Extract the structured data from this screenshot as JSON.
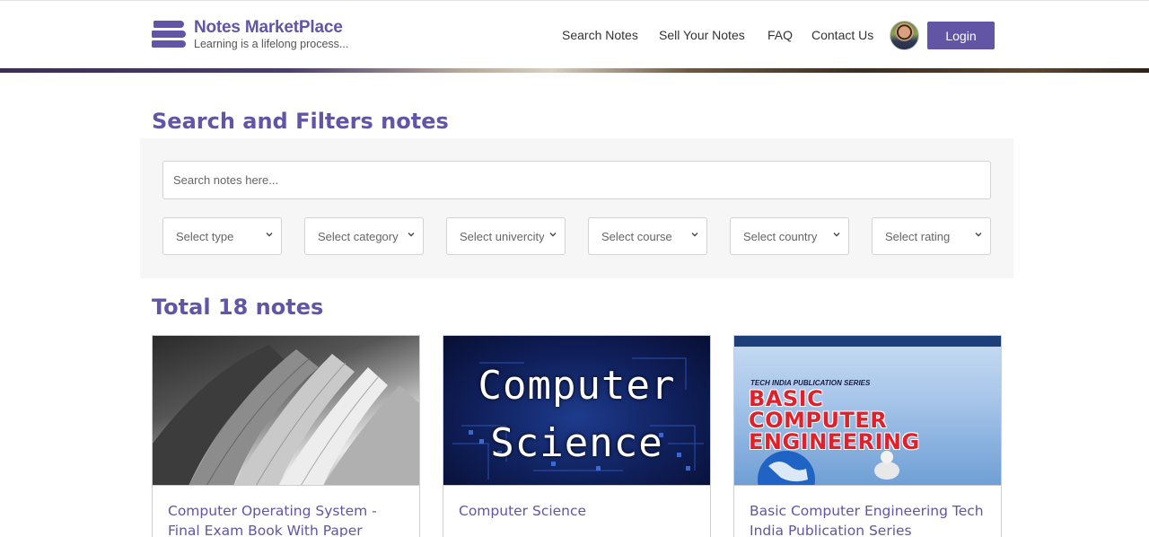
{
  "brand": {
    "title": "Notes MarketPlace",
    "tagline": "Learning is a lifelong process..."
  },
  "nav": {
    "items": [
      "Search Notes",
      "Sell Your Notes",
      "FAQ",
      "Contact Us"
    ],
    "login_label": "Login"
  },
  "search": {
    "heading": "Search and Filters notes",
    "placeholder": "Search notes here...",
    "filters": [
      "Select type",
      "Select category",
      "Select univercity",
      "Select course",
      "Select country",
      "Select rating"
    ]
  },
  "results": {
    "heading": "Total 18 notes",
    "cards": [
      {
        "title": "Computer Operating System - Final Exam Book With Paper Solution",
        "image": "book-pages"
      },
      {
        "title": "Computer Science",
        "image": "computer-science-cover",
        "cover_lines": [
          "Computer",
          "Science"
        ]
      },
      {
        "title": "Basic Computer Engineering Tech India Publication Series",
        "image": "basic-computer-engineering-cover",
        "cover_series": "TECH INDIA PUBLICATION SERIES",
        "cover_lines": [
          "BASIC",
          "COMPUTER",
          "ENGINEERING"
        ]
      }
    ]
  },
  "colors": {
    "accent": "#6255a5",
    "filter_bg": "#f6f6f6",
    "cover_red": "#e0202a"
  }
}
